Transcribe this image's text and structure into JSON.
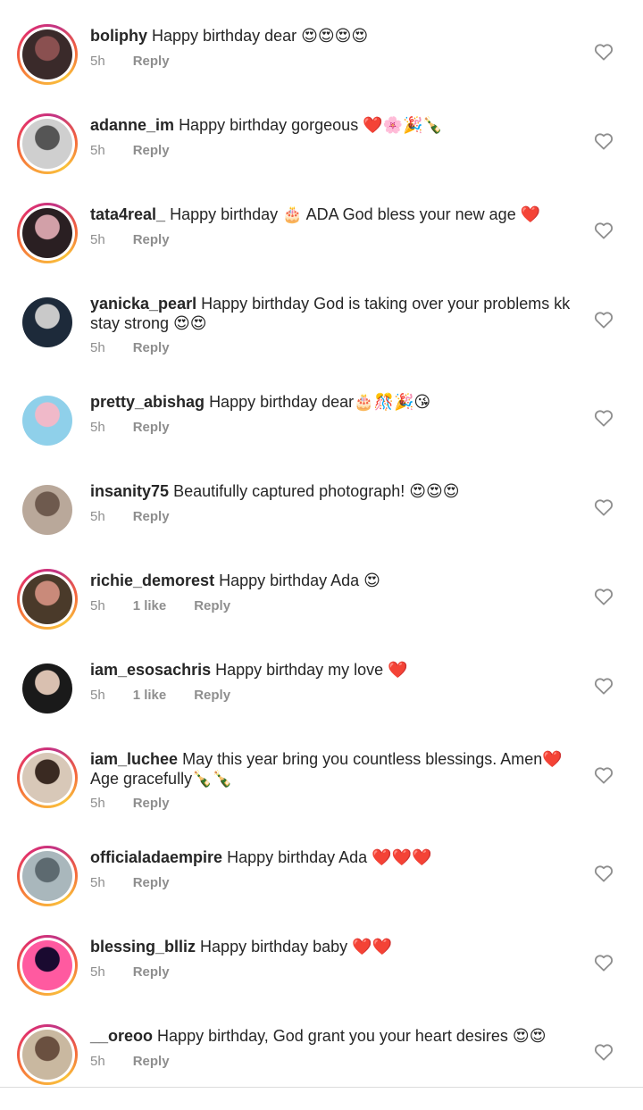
{
  "comments": [
    {
      "username": "boliphy",
      "text": "Happy birthday dear 😍😍😍😍",
      "time": "5h",
      "likes": "",
      "reply": "Reply"
    },
    {
      "username": "adanne_im",
      "text": "Happy birthday gorgeous ❤️🌸🎉🍾",
      "time": "5h",
      "likes": "",
      "reply": "Reply"
    },
    {
      "username": "tata4real_",
      "text": "Happy birthday 🎂 ADA God bless your new age ❤️",
      "time": "5h",
      "likes": "",
      "reply": "Reply"
    },
    {
      "username": "yanicka_pearl",
      "text": "Happy birthday God is taking over your problems kk stay strong 😍😍",
      "time": "5h",
      "likes": "",
      "reply": "Reply"
    },
    {
      "username": "pretty_abishag",
      "text": "Happy birthday dear🎂🎊🎉😘",
      "time": "5h",
      "likes": "",
      "reply": "Reply"
    },
    {
      "username": "insanity75",
      "text": "Beautifully captured photograph! 😍😍😍",
      "time": "5h",
      "likes": "",
      "reply": "Reply"
    },
    {
      "username": "richie_demorest",
      "text": "Happy birthday Ada 😍",
      "time": "5h",
      "likes": "1 like",
      "reply": "Reply"
    },
    {
      "username": "iam_esosachris",
      "text": "Happy birthday my love ❤️",
      "time": "5h",
      "likes": "1 like",
      "reply": "Reply"
    },
    {
      "username": "iam_luchee",
      "text": "May this year bring you countless blessings. Amen❤️ Age gracefully🍾🍾",
      "time": "5h",
      "likes": "",
      "reply": "Reply"
    },
    {
      "username": "officialadaempire",
      "text": "Happy birthday Ada ❤️❤️❤️",
      "time": "5h",
      "likes": "",
      "reply": "Reply"
    },
    {
      "username": "blessing_blliz",
      "text": "Happy birthday baby ❤️❤️",
      "time": "5h",
      "likes": "",
      "reply": "Reply"
    },
    {
      "username": "__oreoo",
      "text": "Happy birthday, God grant you your heart desires 😍😍",
      "time": "5h",
      "likes": "",
      "reply": "Reply"
    }
  ],
  "colors": {
    "text": "#262626",
    "meta": "#8e8e8e",
    "heart_outline": "#8e8e8e"
  },
  "icons": {
    "like": "heart-outline-icon"
  }
}
